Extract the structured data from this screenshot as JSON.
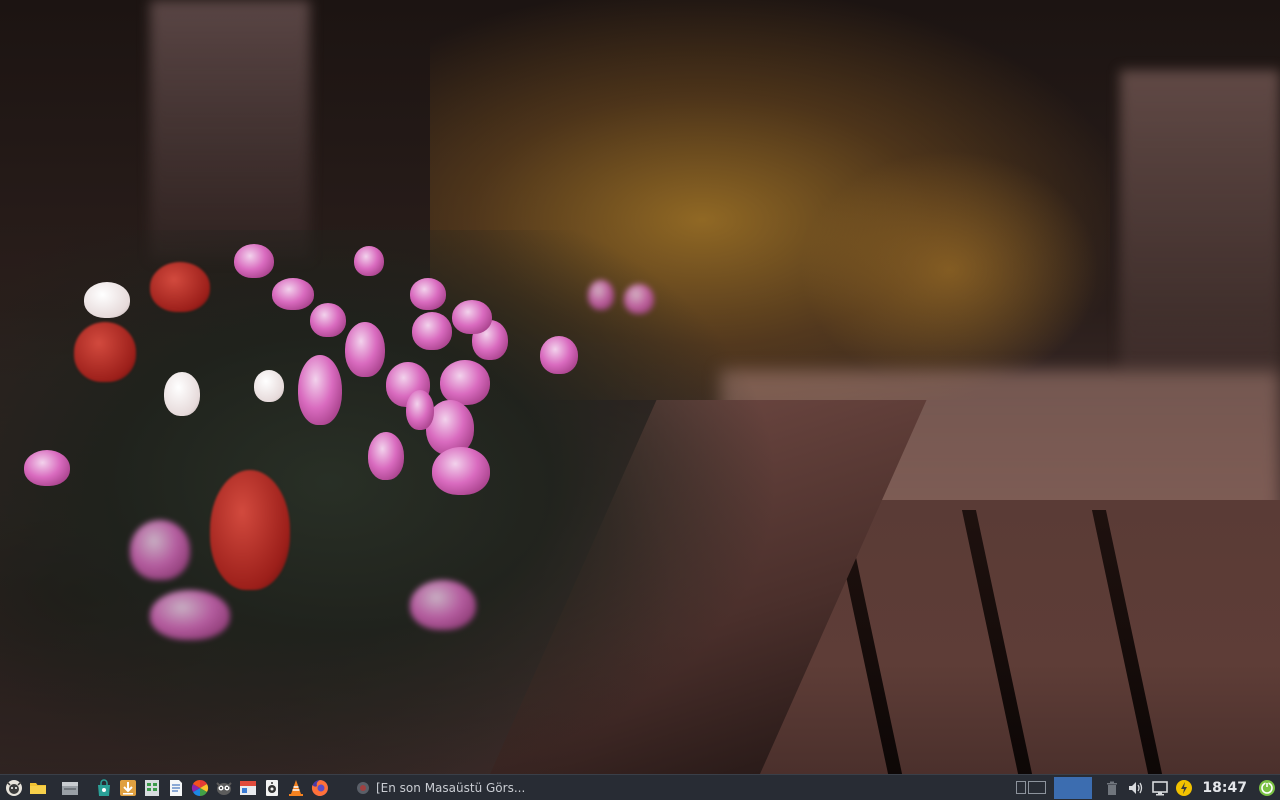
{
  "desktop": {
    "wallpaper": "Blurred bench with cyclamen flowers photo"
  },
  "taskbar": {
    "background": "#282c34",
    "launchers": [
      {
        "name": "menu-lion-icon"
      },
      {
        "name": "folder-icon"
      },
      {
        "name": "file-manager-icon"
      },
      {
        "name": "store-bag-icon"
      },
      {
        "name": "download-icon"
      },
      {
        "name": "spreadsheet-icon"
      },
      {
        "name": "document-icon"
      },
      {
        "name": "color-wheel-icon"
      },
      {
        "name": "owl-icon"
      },
      {
        "name": "panel-icon"
      },
      {
        "name": "speaker-icon"
      },
      {
        "name": "vlc-cone-icon"
      },
      {
        "name": "firefox-icon"
      }
    ],
    "task": {
      "title": "[En son Masaüstü Görs..."
    },
    "tray": {
      "active_color": "#3c6db0",
      "clock": "18:47"
    }
  }
}
